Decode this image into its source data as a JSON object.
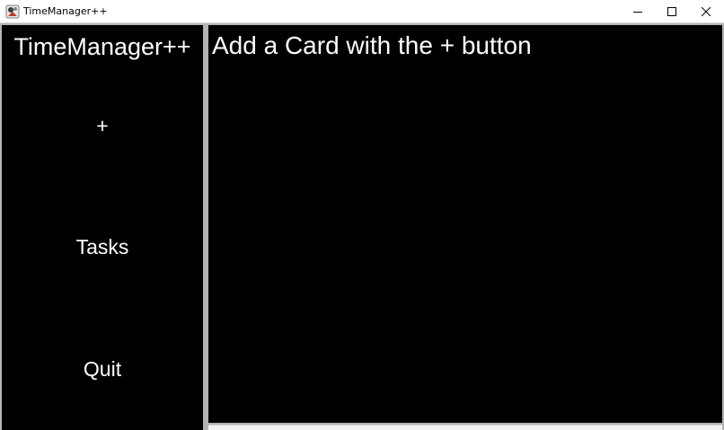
{
  "window": {
    "title": "TimeManager++",
    "controls": {
      "minimize_icon": "minimize-icon",
      "maximize_icon": "maximize-icon",
      "close_icon": "close-icon"
    }
  },
  "sidebar": {
    "heading": "TimeManager++",
    "add_label": "+",
    "tasks_label": "Tasks",
    "quit_label": "Quit"
  },
  "main": {
    "message": "Add a Card with the + button"
  },
  "colors": {
    "background": "#000000",
    "text": "#ffffff",
    "titlebar": "#ffffff",
    "frame": "#b4b4b4"
  }
}
